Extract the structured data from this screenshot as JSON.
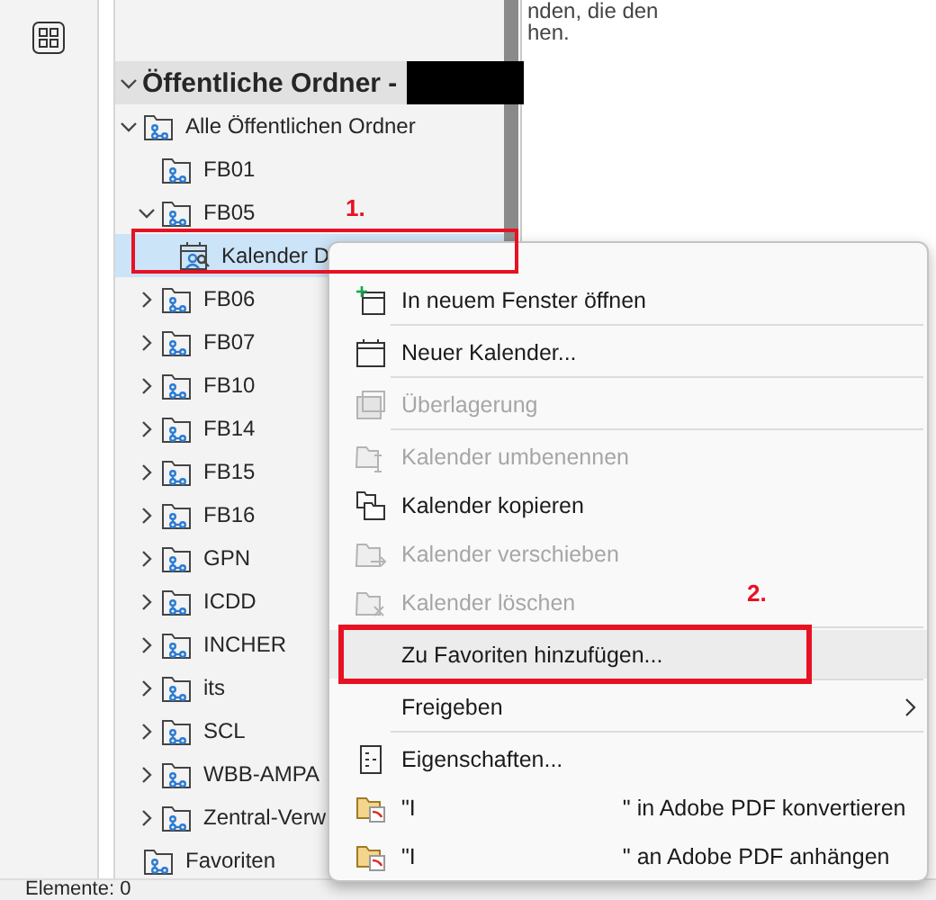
{
  "folder_pane": {
    "header": {
      "label": "Öffentliche Ordner -",
      "expanded": true
    },
    "tree": [
      {
        "label": "Alle Öffentlichen Ordner",
        "kind": "public",
        "expanded": true,
        "selected": false,
        "children": [
          {
            "label": "FB01",
            "kind": "public",
            "selected": false
          },
          {
            "label": "FB05",
            "kind": "public",
            "expanded": true,
            "selected": false,
            "children": [
              {
                "label": "Kalender D",
                "kind": "calendar",
                "selected": true
              }
            ]
          },
          {
            "label": "FB06",
            "kind": "public",
            "expanded": false,
            "selected": false
          },
          {
            "label": "FB07",
            "kind": "public",
            "expanded": false,
            "selected": false
          },
          {
            "label": "FB10",
            "kind": "public",
            "expanded": false,
            "selected": false
          },
          {
            "label": "FB14",
            "kind": "public",
            "expanded": false,
            "selected": false
          },
          {
            "label": "FB15",
            "kind": "public",
            "expanded": false,
            "selected": false
          },
          {
            "label": "FB16",
            "kind": "public",
            "expanded": false,
            "selected": false
          },
          {
            "label": "GPN",
            "kind": "public",
            "expanded": false,
            "selected": false
          },
          {
            "label": "ICDD",
            "kind": "public",
            "expanded": false,
            "selected": false
          },
          {
            "label": "INCHER",
            "kind": "public",
            "expanded": false,
            "selected": false
          },
          {
            "label": "its",
            "kind": "public",
            "expanded": false,
            "selected": false
          },
          {
            "label": "SCL",
            "kind": "public",
            "expanded": false,
            "selected": false
          },
          {
            "label": "WBB-AMPA",
            "kind": "public",
            "expanded": false,
            "selected": false
          },
          {
            "label": "Zentral-Verw",
            "kind": "public",
            "expanded": false,
            "selected": false
          }
        ]
      },
      {
        "label": "Favoriten",
        "kind": "public",
        "selected": false
      }
    ]
  },
  "reading_pane": {
    "lines": [
      "nden, die den",
      "hen."
    ]
  },
  "status_bar": "Elemente: 0",
  "context_menu": [
    {
      "label": "In neuem Fenster öffnen",
      "kind": "open-window",
      "disabled": false,
      "selected": false,
      "submenu": false
    },
    {
      "kind": "separator"
    },
    {
      "label": "Neuer Kalender...",
      "kind": "calendar",
      "disabled": false,
      "selected": false,
      "submenu": false
    },
    {
      "kind": "separator"
    },
    {
      "label": "Überlagerung",
      "kind": "overlay",
      "disabled": true,
      "selected": false,
      "submenu": false
    },
    {
      "kind": "separator"
    },
    {
      "label": "Kalender umbenennen",
      "kind": "rename",
      "disabled": true,
      "selected": false,
      "submenu": false
    },
    {
      "label": "Kalender kopieren",
      "kind": "copy",
      "disabled": false,
      "selected": false,
      "submenu": false
    },
    {
      "label": "Kalender verschieben",
      "kind": "move",
      "disabled": true,
      "selected": false,
      "submenu": false
    },
    {
      "label": "Kalender löschen",
      "kind": "delete",
      "disabled": true,
      "selected": false,
      "submenu": false
    },
    {
      "kind": "separator"
    },
    {
      "label": "Zu Favoriten hinzufügen...",
      "kind": "none",
      "disabled": false,
      "selected": true,
      "submenu": false
    },
    {
      "kind": "separator"
    },
    {
      "label": "Freigeben",
      "kind": "none",
      "disabled": false,
      "selected": false,
      "submenu": true
    },
    {
      "kind": "separator"
    },
    {
      "label": "Eigenschaften...",
      "kind": "properties",
      "disabled": false,
      "selected": false,
      "submenu": false
    },
    {
      "label": "\"I",
      "label_end": "\" in Adobe PDF konvertieren",
      "kind": "pdf",
      "disabled": false,
      "selected": false,
      "submenu": false
    },
    {
      "label": "\"I",
      "label_end": "\" an Adobe PDF anhängen",
      "kind": "pdf",
      "disabled": false,
      "selected": false,
      "submenu": false
    }
  ],
  "annotations": [
    {
      "label": "1."
    },
    {
      "label": "2."
    }
  ]
}
